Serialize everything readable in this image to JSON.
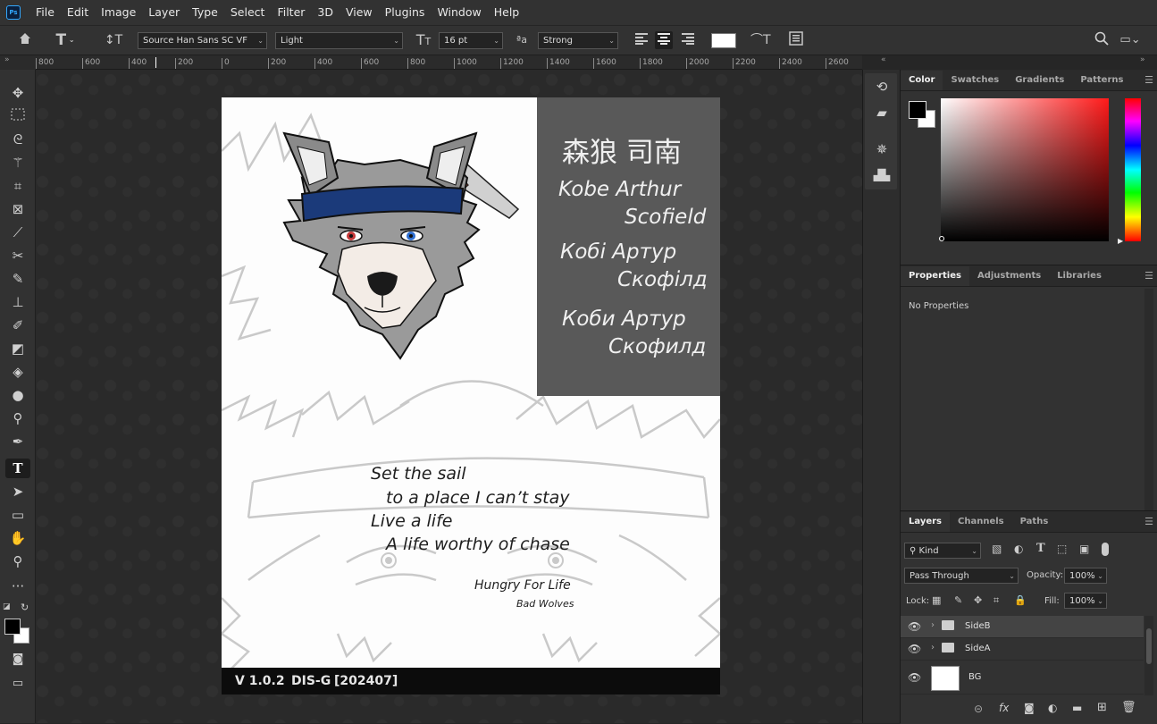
{
  "menu": [
    "File",
    "Edit",
    "Image",
    "Layer",
    "Type",
    "Select",
    "Filter",
    "3D",
    "View",
    "Plugins",
    "Window",
    "Help"
  ],
  "app_logo": "Ps",
  "options": {
    "font_family": "Source Han Sans SC VF",
    "font_style": "Light",
    "font_size": "16 pt",
    "aa_label": "a",
    "antialias": "Strong"
  },
  "ruler_ticks": [
    "800",
    "600",
    "400",
    "200",
    "0",
    "200",
    "400",
    "600",
    "800",
    "1000",
    "1200",
    "1400",
    "1600",
    "1800",
    "2000",
    "2200",
    "2400",
    "2600"
  ],
  "document": {
    "title_cjk": "森狼 司南",
    "name_en_1": "Kobe Arthur",
    "name_en_2": "Scofield",
    "name_uk_1": "Кобі Артур",
    "name_uk_2": "Скофілд",
    "name_ru_1": "Коби Артур",
    "name_ru_2": "Скофилд",
    "lyric_1": "Set the sail",
    "lyric_2": "to a place I can’t stay",
    "lyric_3": "Live a life",
    "lyric_4": "A life worthy of chase",
    "song": "Hungry For Life",
    "artist": "Bad Wolves",
    "version": "V 1.0.2",
    "code": "DIS-G",
    "date": "[202407]"
  },
  "color_panel": {
    "tabs": [
      "Color",
      "Swatches",
      "Gradients",
      "Patterns"
    ],
    "hue_color": "#ff2a2a"
  },
  "properties_panel": {
    "tabs": [
      "Properties",
      "Adjustments",
      "Libraries"
    ],
    "empty_text": "No Properties"
  },
  "layers_panel": {
    "tabs": [
      "Layers",
      "Channels",
      "Paths"
    ],
    "filter_kind": "Kind",
    "blend_mode": "Pass Through",
    "opacity_label": "Opacity:",
    "opacity": "100%",
    "lock_label": "Lock:",
    "fill_label": "Fill:",
    "fill": "100%",
    "layers": [
      {
        "name": "SideB",
        "type": "group"
      },
      {
        "name": "SideA",
        "type": "group"
      },
      {
        "name": "BG",
        "type": "pixel"
      }
    ]
  }
}
